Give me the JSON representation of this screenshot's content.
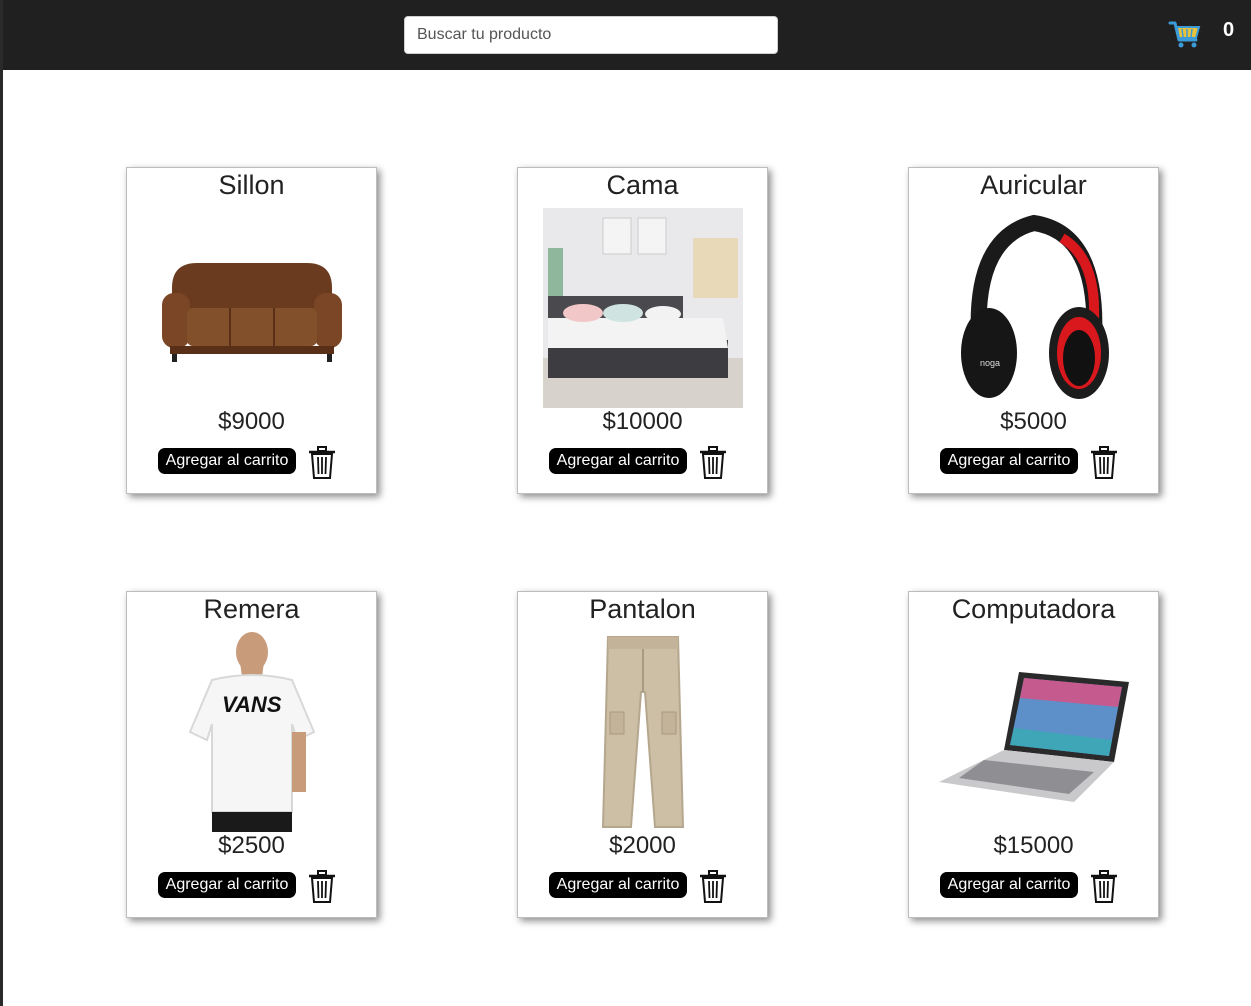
{
  "header": {
    "search_placeholder": "Buscar tu producto",
    "cart_count": "0",
    "cart_icon": "shopping-cart-icon"
  },
  "colors": {
    "header_bg": "#202020",
    "button_bg": "#000000",
    "cart_icon": "#3a9bd8",
    "cart_basket": "#e8c23a"
  },
  "products": [
    {
      "name": "Sillon",
      "price": "$9000",
      "add_label": "Agregar al carrito",
      "image": "sofa"
    },
    {
      "name": "Cama",
      "price": "$10000",
      "add_label": "Agregar al carrito",
      "image": "bed"
    },
    {
      "name": "Auricular",
      "price": "$5000",
      "add_label": "Agregar al carrito",
      "image": "headphones"
    },
    {
      "name": "Remera",
      "price": "$2500",
      "add_label": "Agregar al carrito",
      "image": "t-shirt"
    },
    {
      "name": "Pantalon",
      "price": "$2000",
      "add_label": "Agregar al carrito",
      "image": "pants"
    },
    {
      "name": "Computadora",
      "price": "$15000",
      "add_label": "Agregar al carrito",
      "image": "laptop"
    }
  ]
}
